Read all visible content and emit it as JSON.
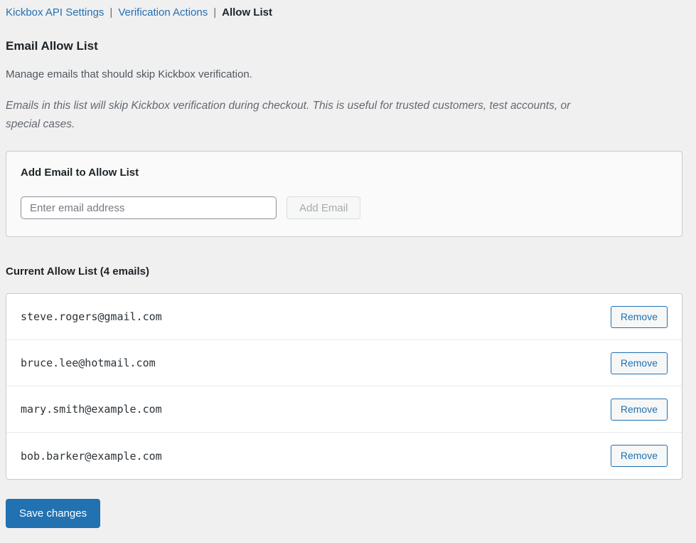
{
  "nav": {
    "links": [
      "Kickbox API Settings",
      "Verification Actions"
    ],
    "current": "Allow List",
    "separator": "|"
  },
  "page": {
    "title": "Email Allow List",
    "subtitle": "Manage emails that should skip Kickbox verification.",
    "note_lines": [
      "Emails in this list will skip Kickbox verification during checkout. This is useful for trusted customers, test accounts, or",
      "special cases."
    ]
  },
  "add_email": {
    "heading": "Add Email to Allow List",
    "input_placeholder": "Enter email address",
    "input_value": "",
    "button_label": "Add Email",
    "button_enabled": false
  },
  "allow_list": {
    "heading": "Current Allow List (4 emails)",
    "emails": [
      "steve.rogers@gmail.com",
      "bruce.lee@hotmail.com",
      "mary.smith@example.com",
      "bob.barker@example.com"
    ],
    "remove_label": "Remove"
  },
  "footer": {
    "save_label": "Save changes"
  },
  "colors": {
    "accent": "#2271b1",
    "page_background": "#f0f0f1",
    "panel_background": "#fafafa",
    "list_background": "#ffffff"
  }
}
